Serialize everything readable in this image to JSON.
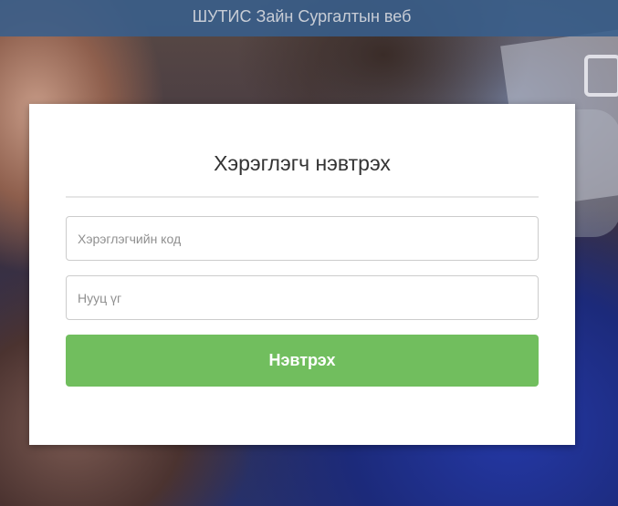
{
  "header": {
    "title": "ШУТИС Зайн Сургалтын веб"
  },
  "login": {
    "title": "Хэрэглэгч нэвтрэх",
    "username": {
      "placeholder": "Хэрэглэгчийн код",
      "value": ""
    },
    "password": {
      "placeholder": "Нууц үг",
      "value": ""
    },
    "submit_label": "Нэвтрэх"
  },
  "colors": {
    "header_bg": "#385e8c",
    "button_bg": "#71be5e",
    "card_bg": "#ffffff"
  }
}
